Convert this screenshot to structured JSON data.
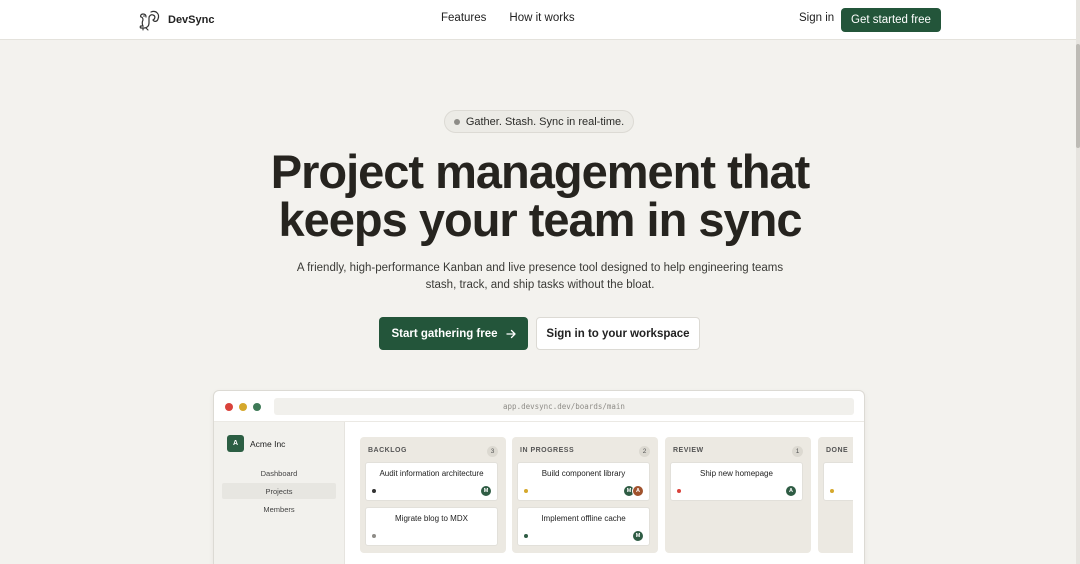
{
  "nav": {
    "brand": "DevSync",
    "links": [
      "Features",
      "How it works"
    ],
    "signin": "Sign in",
    "cta": "Get started free"
  },
  "hero": {
    "badge": "Gather. Stash. Sync in real-time.",
    "headline_line1": "Project management that",
    "headline_line2": "keeps your team in sync",
    "sub_line1": "A friendly, high-performance Kanban and live presence tool designed to help engineering teams",
    "sub_line2": "stash, track, and ship tasks without the bloat.",
    "primary_cta": "Start gathering free",
    "primary_cta_icon": "arrow-right-icon",
    "secondary_cta": "Sign in to your workspace"
  },
  "app_preview": {
    "url": "app.devsync.dev/boards/main",
    "org": {
      "avatar": "A",
      "name": "Acme Inc"
    },
    "sidebar": [
      "Dashboard",
      "Projects",
      "Members"
    ],
    "active_sidebar": "Projects",
    "columns": [
      {
        "title": "BACKLOG",
        "count": "3",
        "cards": [
          {
            "title": "Audit information architecture",
            "priority_color": "#333333",
            "avatars": [
              {
                "l": "M",
                "c": "#2f5c44"
              }
            ]
          },
          {
            "title": "Migrate blog to MDX",
            "priority_color": "#8e8c87",
            "avatars": []
          }
        ]
      },
      {
        "title": "IN PROGRESS",
        "count": "2",
        "cards": [
          {
            "title": "Build component library",
            "priority_color": "#d5a82c",
            "avatars": [
              {
                "l": "M",
                "c": "#2f5c44"
              },
              {
                "l": "A",
                "c": "#a0522d"
              }
            ]
          },
          {
            "title": "Implement offline cache",
            "priority_color": "#2f5c44",
            "avatars": [
              {
                "l": "M",
                "c": "#2f5c44"
              }
            ]
          }
        ]
      },
      {
        "title": "REVIEW",
        "count": "1",
        "cards": [
          {
            "title": "Ship new homepage",
            "priority_color": "#d9423b",
            "avatars": [
              {
                "l": "A",
                "c": "#2f5c44"
              }
            ]
          }
        ]
      },
      {
        "title": "DONE",
        "count": "",
        "cards": [
          {
            "title": "",
            "priority_color": "#d5a82c",
            "avatars": []
          }
        ]
      }
    ]
  }
}
